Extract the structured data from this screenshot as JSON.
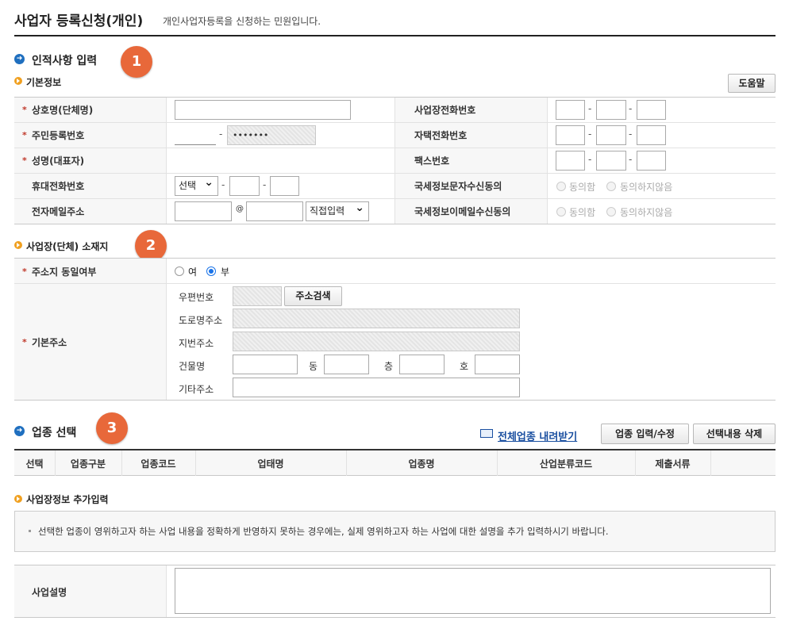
{
  "page": {
    "title": "사업자 등록신청(개인)",
    "subtitle": "개인사업자등록을 신청하는 민원입니다."
  },
  "badges": [
    "1",
    "2",
    "3"
  ],
  "section_personal": {
    "title": "인적사항 입력",
    "subsection": "기본정보",
    "help_button": "도움말",
    "fields": {
      "company_name": "상호명(단체명)",
      "resident_number": "주민등록번호",
      "resident_masked": "•••••••",
      "name": "성명(대표자)",
      "mobile": "휴대전화번호",
      "mobile_select": "선택",
      "email": "전자메일주소",
      "email_at": "@",
      "email_select": "직접입력",
      "business_phone": "사업장전화번호",
      "home_phone": "자택전화번호",
      "fax": "팩스번호",
      "sms_consent": "국세정보문자수신동의",
      "email_consent": "국세정보이메일수신동의",
      "agree": "동의함",
      "disagree": "동의하지않음",
      "dash": "-",
      "required_mark": "*"
    }
  },
  "section_location": {
    "title": "사업장(단체) 소재지",
    "same_address_label": "주소지 동일여부",
    "yes": "여",
    "no": "부",
    "base_address_label": "기본주소",
    "postal_code": "우편번호",
    "address_search_button": "주소검색",
    "road_address": "도로명주소",
    "lot_address": "지번주소",
    "building_name": "건물명",
    "dong": "동",
    "floor": "층",
    "ho": "호",
    "other_address": "기타주소"
  },
  "section_industry": {
    "title": "업종 선택",
    "download_link": "전체업종 내려받기",
    "input_button": "업종 입력/수정",
    "delete_button": "선택내용 삭제",
    "columns": [
      "선택",
      "업종구분",
      "업종코드",
      "업태명",
      "업종명",
      "산업분류코드",
      "제출서류"
    ]
  },
  "section_extra": {
    "title": "사업장정보 추가입력",
    "note": "선택한 업종이 영위하고자 하는 사업 내용을 정확하게 반영하지 못하는 경우에는, 실제 영위하고자 하는 사업에 대한 설명을 추가 입력하시기 바랍니다.",
    "description_label": "사업설명"
  },
  "colors": {
    "section_icon": "#1f6fbf",
    "sub_icon": "#f0a020",
    "badge": "#e8683a",
    "required": "#c0392b",
    "link": "#1a4fa0"
  }
}
